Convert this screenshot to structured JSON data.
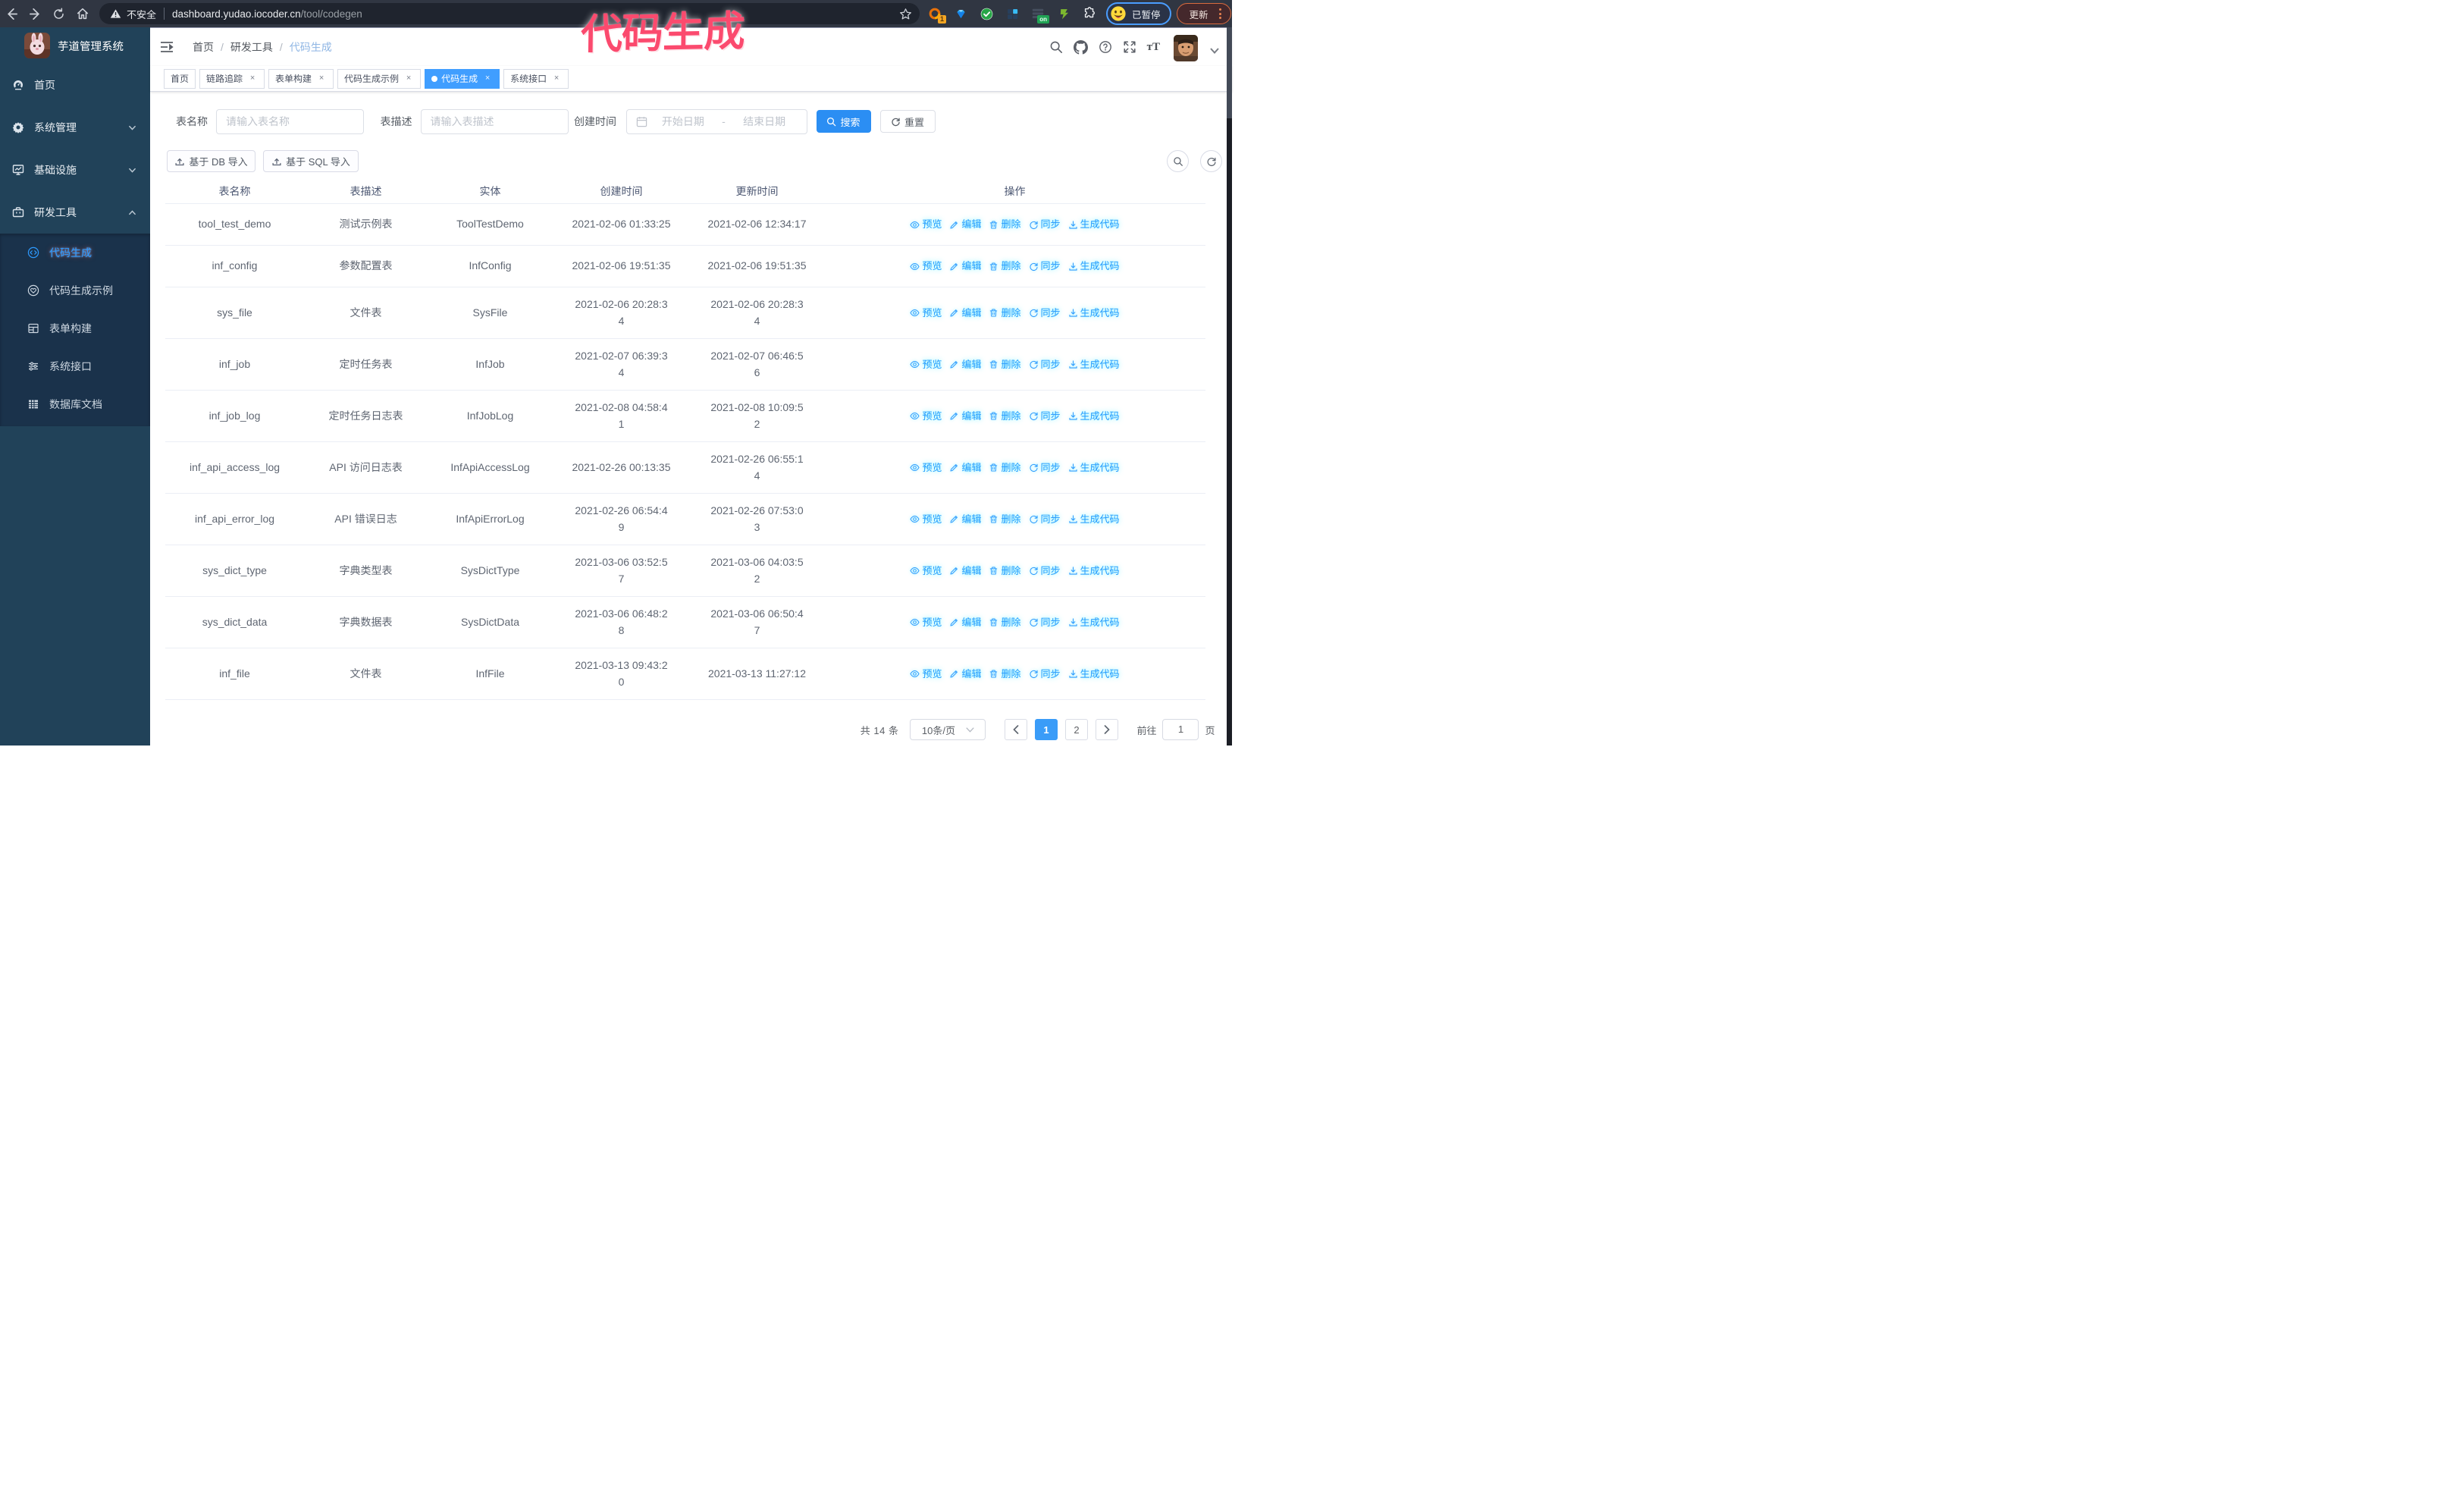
{
  "colors": {
    "accent": "#409eff",
    "sidebar_bg": "#23455e",
    "submenu_bg": "#1b3349",
    "chrome_bg": "#303642",
    "omnibox_bg": "#1f242e",
    "annotation": "#fb4a6e",
    "update_accent": "#ff8a50",
    "profile_ring": "#4a9dff"
  },
  "browser": {
    "security_label": "不安全",
    "url_host": "dashboard.yudao.iocoder.cn",
    "url_path": "/tool/codegen",
    "profile_label": "已暂停",
    "update_label": "更新",
    "extension_badge": "1",
    "extension_on_badge": "on",
    "nav_icons": [
      "arrow-left-icon",
      "arrow-right-icon",
      "reload-icon",
      "home-icon"
    ],
    "omnibox_icons": [
      "warning-triangle-icon",
      "star-icon"
    ],
    "extension_icons": [
      "proxy-ring-icon",
      "gem-icon",
      "check-circle-icon",
      "grid-squares-icon",
      "rows-on-icon",
      "clipper-icon",
      "puzzle-icon"
    ],
    "profile_icon": "emoji-face-icon",
    "menu_icon": "kebab-icon"
  },
  "annotation": {
    "text": "代码生成"
  },
  "sidebar": {
    "logo_title": "芋道管理系统",
    "menu": [
      {
        "label": "首页",
        "icon": "dashboard-icon",
        "expandable": false
      },
      {
        "label": "系统管理",
        "icon": "gear-icon",
        "expandable": true
      },
      {
        "label": "基础设施",
        "icon": "infra-icon",
        "expandable": true
      },
      {
        "label": "研发工具",
        "icon": "tools-icon",
        "expandable": true,
        "expanded": true
      }
    ],
    "submenu": [
      {
        "label": "代码生成",
        "icon": "code-icon",
        "active": true
      },
      {
        "label": "代码生成示例",
        "icon": "example-icon"
      },
      {
        "label": "表单构建",
        "icon": "form-icon"
      },
      {
        "label": "系统接口",
        "icon": "api-icon"
      },
      {
        "label": "数据库文档",
        "icon": "db-doc-icon"
      }
    ]
  },
  "breadcrumb": [
    "首页",
    "研发工具",
    "代码生成"
  ],
  "tabs": [
    {
      "label": "首页",
      "closable": false
    },
    {
      "label": "链路追踪",
      "closable": true
    },
    {
      "label": "表单构建",
      "closable": true
    },
    {
      "label": "代码生成示例",
      "closable": true
    },
    {
      "label": "代码生成",
      "closable": true,
      "active": true
    },
    {
      "label": "系统接口",
      "closable": true
    }
  ],
  "filters": {
    "name_label": "表名称",
    "name_placeholder": "请输入表名称",
    "desc_label": "表描述",
    "desc_placeholder": "请输入表描述",
    "time_label": "创建时间",
    "date_start_placeholder": "开始日期",
    "date_separator": "-",
    "date_end_placeholder": "结束日期",
    "search_label": "搜索",
    "reset_label": "重置",
    "date_icon": "calendar-icon",
    "search_icon": "search-icon",
    "reset_icon": "refresh-icon"
  },
  "toolbar": {
    "import_db_label": "基于 DB 导入",
    "import_sql_label": "基于 SQL 导入",
    "import_icon": "upload-icon",
    "right_tool_icons": [
      "search-icon",
      "refresh-icon"
    ]
  },
  "table": {
    "columns": [
      "表名称",
      "表描述",
      "实体",
      "创建时间",
      "更新时间",
      "操作"
    ],
    "actions": [
      "预览",
      "编辑",
      "删除",
      "同步",
      "生成代码"
    ],
    "rows": [
      {
        "name": "tool_test_demo",
        "desc": "测试示例表",
        "entity": "ToolTestDemo",
        "created": "2021-02-06 01:33:25",
        "created_lines": [
          "2021-02-06 01:33:25"
        ],
        "updated": "2021-02-06 12:34:17",
        "updated_lines": [
          "2021-02-06 12:34:17"
        ]
      },
      {
        "name": "inf_config",
        "desc": "参数配置表",
        "entity": "InfConfig",
        "created": "2021-02-06 19:51:35",
        "created_lines": [
          "2021-02-06 19:51:35"
        ],
        "updated": "2021-02-06 19:51:35",
        "updated_lines": [
          "2021-02-06 19:51:35"
        ]
      },
      {
        "name": "sys_file",
        "desc": "文件表",
        "entity": "SysFile",
        "created": "2021-02-06 20:28:34",
        "created_lines": [
          "2021-02-06 20:28:3",
          "4"
        ],
        "updated": "2021-02-06 20:28:34",
        "updated_lines": [
          "2021-02-06 20:28:3",
          "4"
        ]
      },
      {
        "name": "inf_job",
        "desc": "定时任务表",
        "entity": "InfJob",
        "created": "2021-02-07 06:39:34",
        "created_lines": [
          "2021-02-07 06:39:3",
          "4"
        ],
        "updated": "2021-02-07 06:46:56",
        "updated_lines": [
          "2021-02-07 06:46:5",
          "6"
        ]
      },
      {
        "name": "inf_job_log",
        "desc": "定时任务日志表",
        "entity": "InfJobLog",
        "created": "2021-02-08 04:58:41",
        "created_lines": [
          "2021-02-08 04:58:4",
          "1"
        ],
        "updated": "2021-02-08 10:09:52",
        "updated_lines": [
          "2021-02-08 10:09:5",
          "2"
        ]
      },
      {
        "name": "inf_api_access_log",
        "desc": "API 访问日志表",
        "entity": "InfApiAccessLog",
        "created": "2021-02-26 00:13:35",
        "created_lines": [
          "2021-02-26 00:13:35"
        ],
        "updated": "2021-02-26 06:55:14",
        "updated_lines": [
          "2021-02-26 06:55:1",
          "4"
        ]
      },
      {
        "name": "inf_api_error_log",
        "desc": "API 错误日志",
        "entity": "InfApiErrorLog",
        "created": "2021-02-26 06:54:49",
        "created_lines": [
          "2021-02-26 06:54:4",
          "9"
        ],
        "updated": "2021-02-26 07:53:03",
        "updated_lines": [
          "2021-02-26 07:53:0",
          "3"
        ]
      },
      {
        "name": "sys_dict_type",
        "desc": "字典类型表",
        "entity": "SysDictType",
        "created": "2021-03-06 03:52:57",
        "created_lines": [
          "2021-03-06 03:52:5",
          "7"
        ],
        "updated": "2021-03-06 04:03:52",
        "updated_lines": [
          "2021-03-06 04:03:5",
          "2"
        ]
      },
      {
        "name": "sys_dict_data",
        "desc": "字典数据表",
        "entity": "SysDictData",
        "created": "2021-03-06 06:48:28",
        "created_lines": [
          "2021-03-06 06:48:2",
          "8"
        ],
        "updated": "2021-03-06 06:50:47",
        "updated_lines": [
          "2021-03-06 06:50:4",
          "7"
        ]
      },
      {
        "name": "inf_file",
        "desc": "文件表",
        "entity": "InfFile",
        "created": "2021-03-13 09:43:20",
        "created_lines": [
          "2021-03-13 09:43:2",
          "0"
        ],
        "updated": "2021-03-13 11:27:12",
        "updated_lines": [
          "2021-03-13 11:27:12"
        ]
      }
    ],
    "action_icons": [
      "eye-icon",
      "pencil-icon",
      "trash-icon",
      "sync-icon",
      "download-icon"
    ]
  },
  "pagination": {
    "total_label": "共 14 条",
    "page_size_label": "10条/页",
    "pages": [
      "1",
      "2"
    ],
    "active_page": "1",
    "goto_label": "前往",
    "goto_value": "1",
    "goto_unit": "页",
    "prev_icon": "chevron-left-icon",
    "next_icon": "chevron-right-icon"
  },
  "navbar": {
    "toggle_icon": "hamburger-icon",
    "tool_icons": [
      "search-icon",
      "github-icon",
      "question-circle-icon",
      "fullscreen-icon",
      "font-size-icon"
    ],
    "avatar_icon": "avatar-photo-icon",
    "caret_icon": "chevron-down-icon"
  }
}
